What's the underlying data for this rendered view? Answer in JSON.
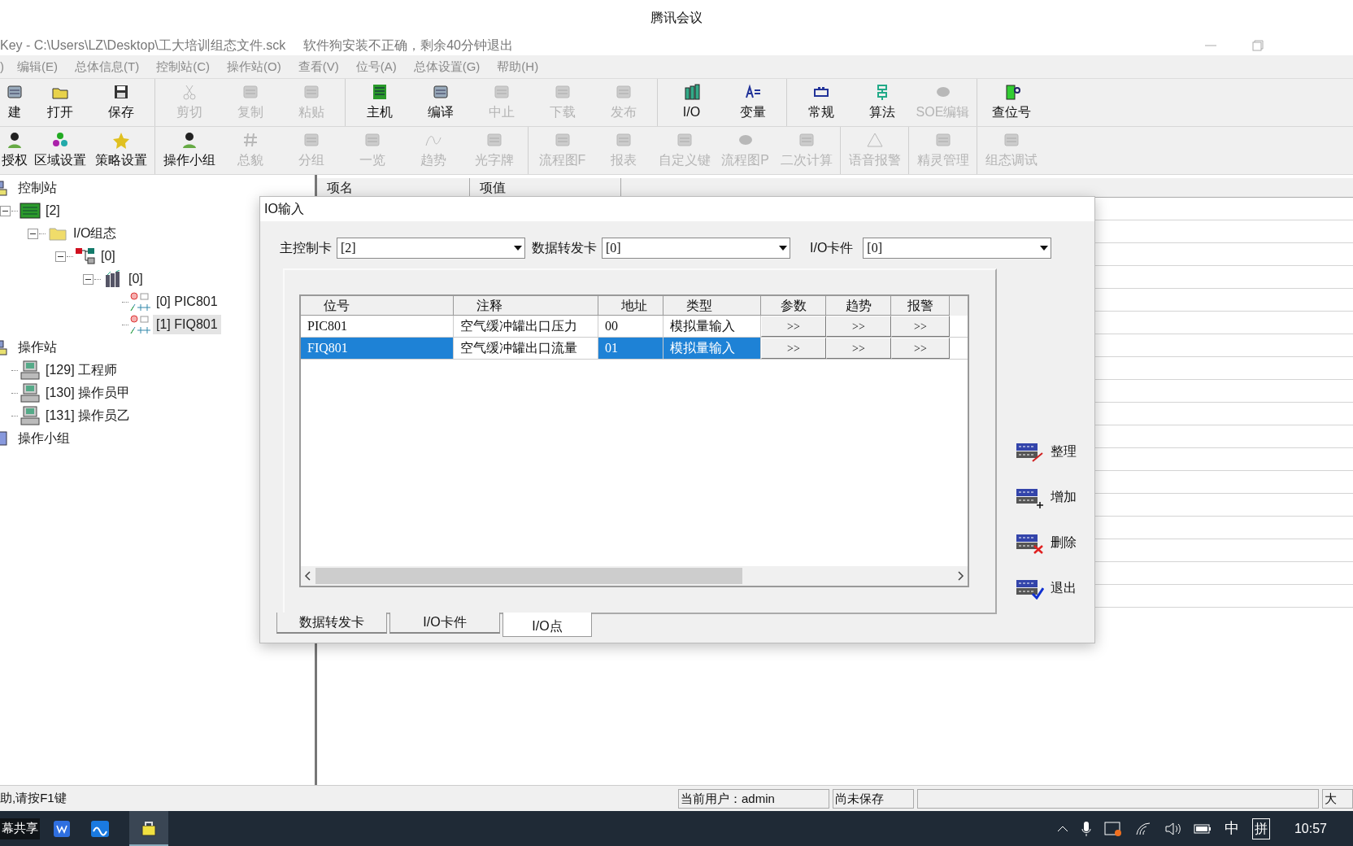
{
  "meeting_title": "腾讯会议",
  "window": {
    "title": "Key - C:\\Users\\LZ\\Desktop\\工大培训组态文件.sck",
    "notice": "软件狗安装不正确，剩余40分钟退出"
  },
  "menu": [
    ")",
    "编辑(E)",
    "总体信息(T)",
    "控制站(C)",
    "操作站(O)",
    "查看(V)",
    "位号(A)",
    "总体设置(G)",
    "帮助(H)"
  ],
  "toolbars": [
    [
      [
        {
          "label": "建",
          "disabled": false
        },
        {
          "label": "打开",
          "disabled": false
        },
        {
          "label": "保存",
          "disabled": false
        }
      ],
      [
        {
          "label": "剪切",
          "disabled": true
        },
        {
          "label": "复制",
          "disabled": true
        },
        {
          "label": "粘贴",
          "disabled": true
        }
      ],
      [
        {
          "label": "主机",
          "disabled": false
        },
        {
          "label": "编译",
          "disabled": false
        },
        {
          "label": "中止",
          "disabled": true
        },
        {
          "label": "下载",
          "disabled": true
        },
        {
          "label": "发布",
          "disabled": true
        }
      ],
      [
        {
          "label": "I/O",
          "disabled": false
        },
        {
          "label": "变量",
          "disabled": false
        }
      ],
      [
        {
          "label": "常规",
          "disabled": false
        },
        {
          "label": "算法",
          "disabled": false
        },
        {
          "label": "SOE编辑",
          "disabled": true
        }
      ],
      [
        {
          "label": "查位号",
          "disabled": false
        }
      ]
    ],
    [
      [
        {
          "label": "授权",
          "disabled": false
        },
        {
          "label": "区域设置",
          "disabled": false
        },
        {
          "label": "策略设置",
          "disabled": false
        }
      ],
      [
        {
          "label": "操作小组",
          "disabled": false
        },
        {
          "label": "总貌",
          "disabled": true
        },
        {
          "label": "分组",
          "disabled": true
        },
        {
          "label": "一览",
          "disabled": true
        },
        {
          "label": "趋势",
          "disabled": true
        },
        {
          "label": "光字牌",
          "disabled": true
        }
      ],
      [
        {
          "label": "流程图F",
          "disabled": true
        },
        {
          "label": "报表",
          "disabled": true
        },
        {
          "label": "自定义键",
          "disabled": true
        },
        {
          "label": "流程图P",
          "disabled": true
        },
        {
          "label": "二次计算",
          "disabled": true
        }
      ],
      [
        {
          "label": "语音报警",
          "disabled": true
        }
      ],
      [
        {
          "label": "精灵管理",
          "disabled": true
        }
      ],
      [
        {
          "label": "组态调试",
          "disabled": true
        }
      ]
    ]
  ],
  "tree": [
    {
      "label": "控制站",
      "kind": "stations",
      "selected": false,
      "children": [
        {
          "label": "[2]",
          "kind": "controller",
          "selected": false,
          "expanded": true,
          "children": [
            {
              "label": "I/O组态",
              "kind": "folder",
              "selected": false,
              "expanded": true,
              "children": [
                {
                  "label": "[0]",
                  "kind": "network",
                  "selected": false,
                  "expanded": true,
                  "children": [
                    {
                      "label": "[0]",
                      "kind": "card",
                      "selected": false,
                      "expanded": true,
                      "children": [
                        {
                          "label": "[0] PIC801",
                          "kind": "point",
                          "selected": false
                        },
                        {
                          "label": "[1] FIQ801",
                          "kind": "point",
                          "selected": true
                        }
                      ]
                    }
                  ]
                }
              ]
            }
          ]
        }
      ]
    },
    {
      "label": "操作站",
      "kind": "stations",
      "selected": false,
      "children": [
        {
          "label": "[129] 工程师",
          "kind": "computer",
          "selected": false
        },
        {
          "label": "[130] 操作员甲",
          "kind": "computer",
          "selected": false
        },
        {
          "label": "[131] 操作员乙",
          "kind": "computer",
          "selected": false
        }
      ]
    },
    {
      "label": "操作小组",
      "kind": "group",
      "selected": false
    }
  ],
  "list_columns": [
    "项名",
    "项值"
  ],
  "dialog": {
    "title": "IO输入",
    "fields": [
      {
        "label": "主控制卡",
        "value": "[2]"
      },
      {
        "label": "数据转发卡",
        "value": "[0]"
      },
      {
        "label": "I/O卡件",
        "value": "[0]"
      }
    ],
    "columns": [
      "位号",
      "注释",
      "地址",
      "类型",
      "参数",
      "趋势",
      "报警"
    ],
    "rows": [
      {
        "cells": [
          "PIC801",
          "空气缓冲罐出口压力",
          "00",
          "模拟量输入"
        ],
        "buttons": [
          ">>",
          ">>",
          ">>"
        ],
        "selected": false
      },
      {
        "cells": [
          "FIQ801",
          "空气缓冲罐出口流量",
          "01",
          "模拟量输入"
        ],
        "buttons": [
          ">>",
          ">>",
          ">>"
        ],
        "selected": true
      }
    ],
    "tabs": [
      {
        "label": "数据转发卡",
        "selected": false
      },
      {
        "label": "I/O卡件",
        "selected": false
      },
      {
        "label": "I/O点",
        "selected": true
      }
    ],
    "side_buttons": [
      "整理",
      "增加",
      "删除",
      "退出"
    ]
  },
  "status_bar": [
    "助,请按F1键",
    "当前用户：admin",
    "尚未保存",
    "大"
  ],
  "taskbar": {
    "share_label": "幕共享",
    "ime": "中",
    "ime_mode": "拼",
    "time": "10:57"
  }
}
